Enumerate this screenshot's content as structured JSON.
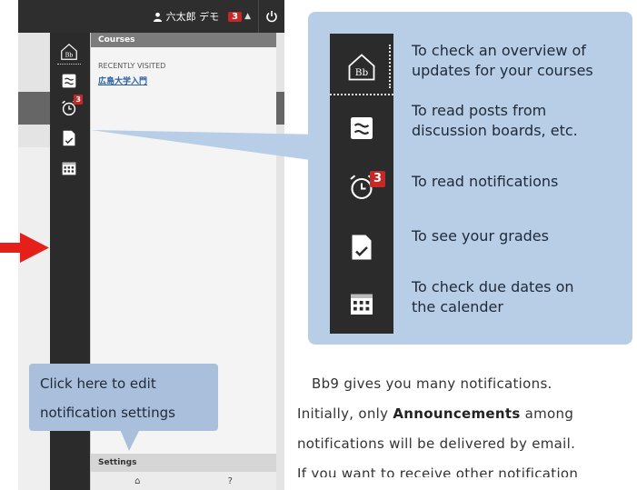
{
  "topbar": {
    "user_name": "六太郎 デモ",
    "notification_count": "3",
    "icons": [
      "user-icon",
      "caret-up-icon",
      "power-icon"
    ]
  },
  "side_nav": {
    "icons": [
      "blackboard-home-icon",
      "discussion-icon",
      "alarm-clock-icon",
      "grades-icon",
      "calendar-icon"
    ],
    "badge": "3"
  },
  "panel": {
    "header": "Courses",
    "section_label": "RECENTLY VISITED",
    "course_link": "広島大学入門",
    "settings_label": "Settings",
    "footer_home": "⌂",
    "footer_help": "?"
  },
  "callout": {
    "line1": "Click here to edit",
    "line2": "notification settings"
  },
  "legend": {
    "badge": "3",
    "items": [
      {
        "icon": "blackboard-home-icon",
        "text_line1": "To check an overview of",
        "text_line2": "updates for your courses"
      },
      {
        "icon": "discussion-icon",
        "text_line1": "To read posts from",
        "text_line2": "discussion boards,  etc."
      },
      {
        "icon": "alarm-clock-icon",
        "text_line1": "To read notifications",
        "text_line2": ""
      },
      {
        "icon": "grades-icon",
        "text_line1": "To see your grades",
        "text_line2": ""
      },
      {
        "icon": "calendar-icon",
        "text_line1": "To check due dates on",
        "text_line2": "the calender"
      }
    ]
  },
  "body_text": {
    "line1": "Bb9 gives you many notifications.",
    "line2_pre": "Initially, only ",
    "line2_bold": "Announcements",
    "line2_post": " among",
    "line3": "notifications will be delivered by email.",
    "line4": "If you want to receive other notification"
  },
  "colors": {
    "accent_red": "#e5201b",
    "badge_red": "#c62828",
    "callout_blue": "#a9bfdc",
    "legend_blue": "#b8cde6",
    "dark_bar": "#2b2b2b"
  }
}
